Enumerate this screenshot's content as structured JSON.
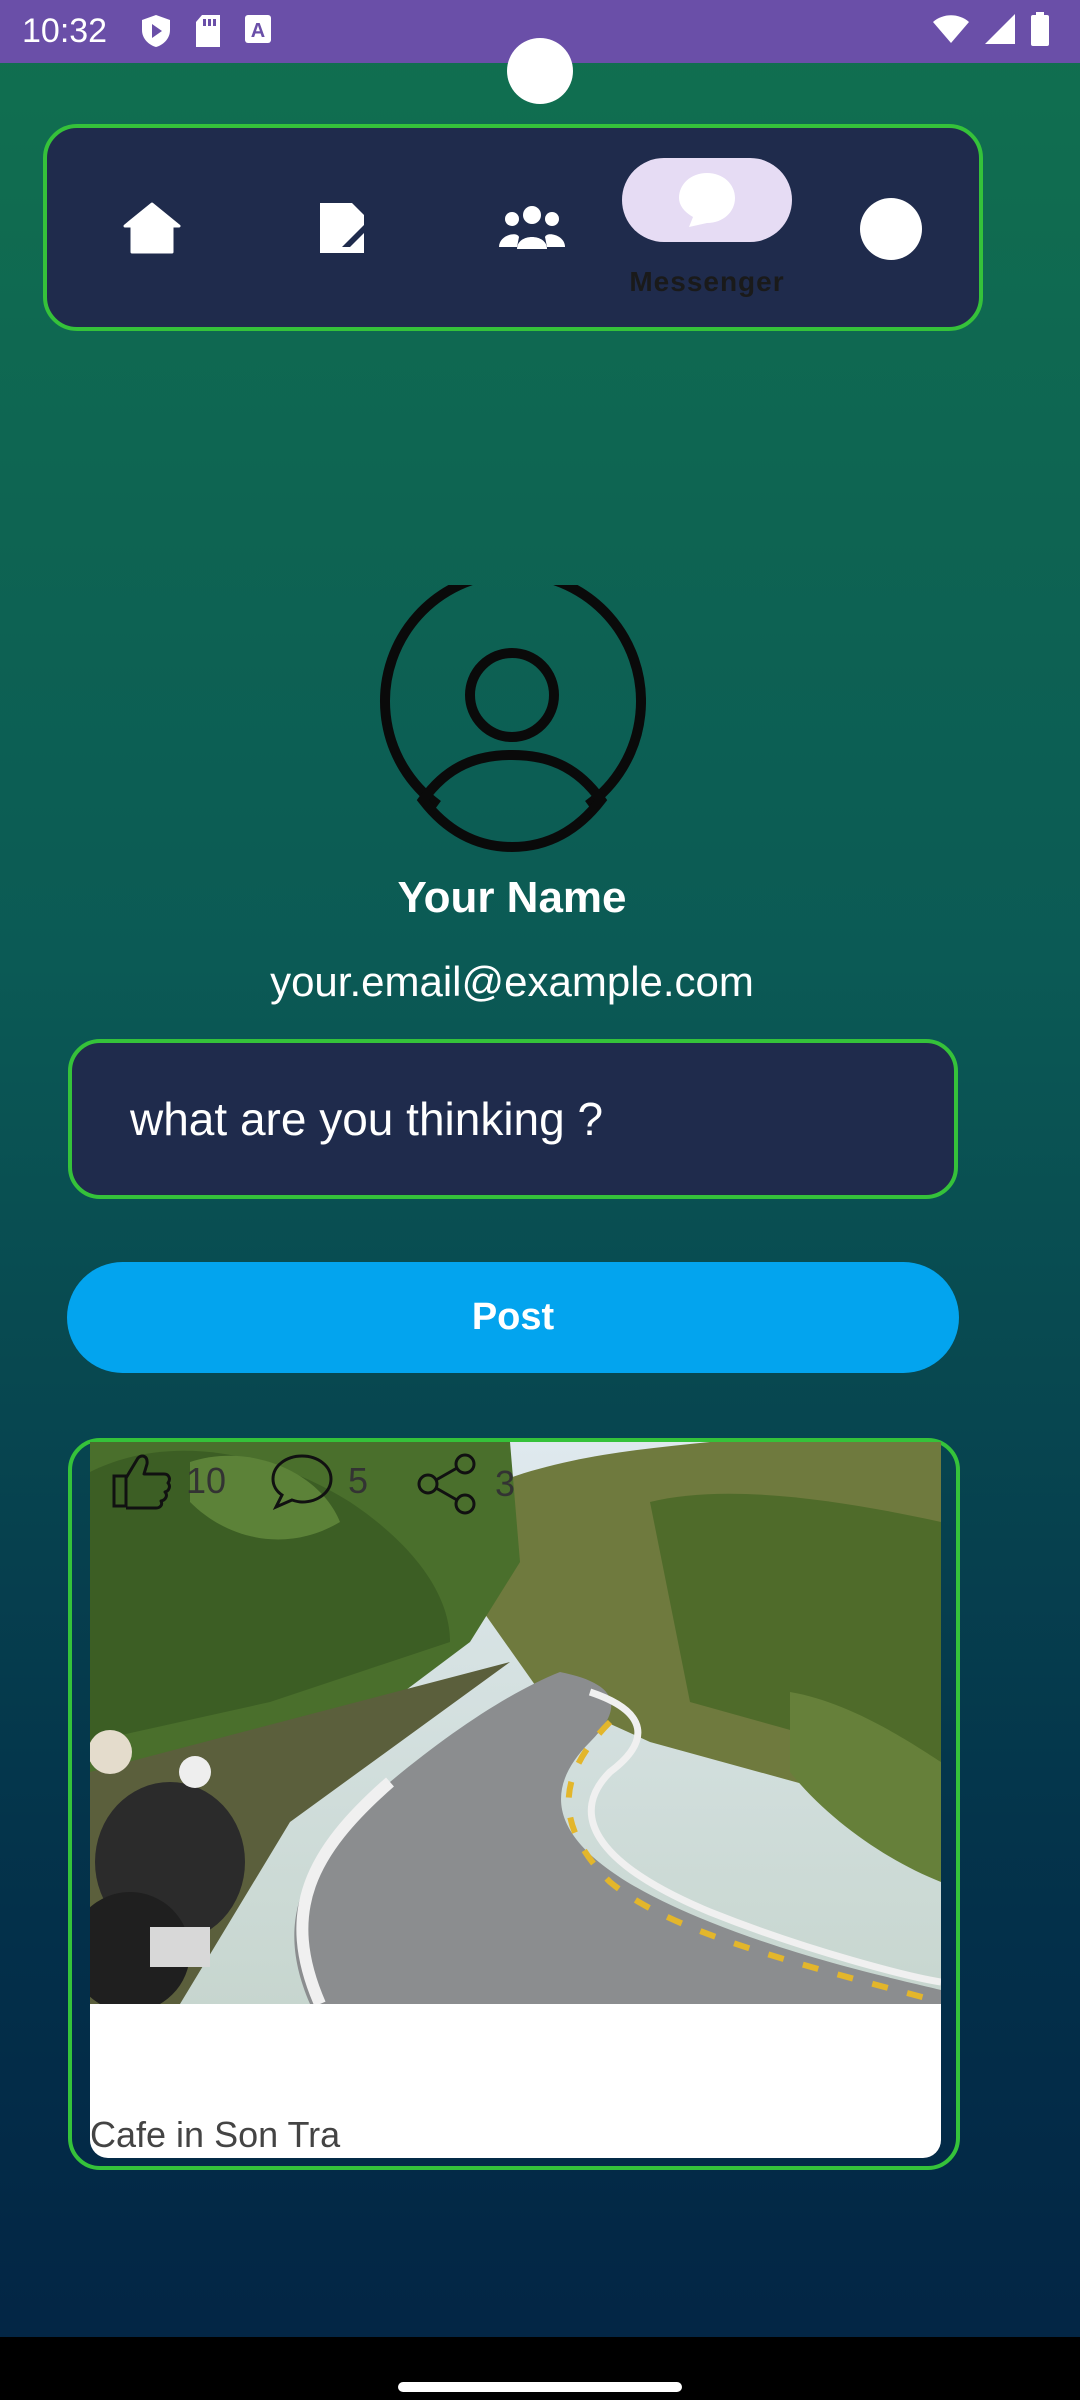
{
  "status_bar": {
    "time": "10:32",
    "left_icons": [
      "shield-play-icon",
      "sd-card-icon",
      "keyboard-a-icon"
    ],
    "right_icons": [
      "wifi-icon",
      "signal-icon",
      "battery-icon"
    ],
    "color": "#6a4fa8"
  },
  "top_nav": {
    "items": [
      {
        "name": "home",
        "icon": "home-icon"
      },
      {
        "name": "documents",
        "icon": "document-icon"
      },
      {
        "name": "groups",
        "icon": "group-icon"
      },
      {
        "name": "messenger",
        "icon": "chat-bubble-icon",
        "label": "Messenger",
        "selected": true
      },
      {
        "name": "profile",
        "icon": "profile-dot-icon"
      }
    ],
    "accent": "#35c23a"
  },
  "profile": {
    "name": "Your Name",
    "email": "your.email@example.com"
  },
  "composer": {
    "text": "what are you thinking ?"
  },
  "post_button": {
    "label": "Post",
    "color": "#03a4ee"
  },
  "post": {
    "image": "winding-road-photo",
    "likes": "10",
    "comments": "5",
    "shares": "3",
    "caption": "Cafe in Son Tra"
  }
}
